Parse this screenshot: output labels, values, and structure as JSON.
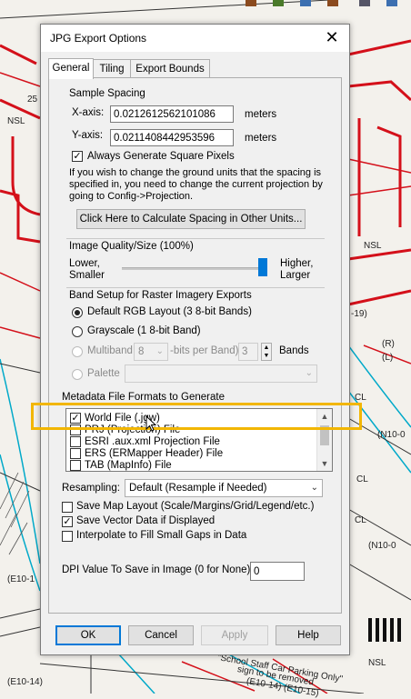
{
  "dialog": {
    "title": "JPG Export Options",
    "close_glyph": "✕",
    "tabs": [
      {
        "label": "General",
        "active": true
      },
      {
        "label": "Tiling",
        "active": false
      },
      {
        "label": "Export Bounds",
        "active": false
      }
    ]
  },
  "sample_spacing": {
    "heading": "Sample Spacing",
    "x_label": "X-axis:",
    "x_value": "0.0212612562101086",
    "x_unit": "meters",
    "y_label": "Y-axis:",
    "y_value": "0.0211408442953596",
    "y_unit": "meters",
    "square_pixels_label": "Always Generate Square Pixels",
    "square_pixels_checked": true,
    "info_text_1": "If you wish to change the ground units that the spacing is",
    "info_text_2": "specified in, you need to change the current projection by",
    "info_text_3": "going to Config->Projection.",
    "calc_button": "Click Here to Calculate Spacing in Other Units..."
  },
  "quality": {
    "heading": "Image Quality/Size (100%)",
    "lower_1": "Lower,",
    "lower_2": "Smaller",
    "higher_1": "Higher,",
    "higher_2": "Larger",
    "level": 1.0
  },
  "band_setup": {
    "heading": "Band Setup for Raster Imagery Exports",
    "rgb_label": "Default RGB Layout (3 8-bit Bands)",
    "gray_label": "Grayscale (1 8-bit Band)",
    "multiband_label": "Multiband (",
    "multiband_bits": "8",
    "multiband_mid": "-bits per Band)",
    "band_count": "3",
    "bands_label": "Bands",
    "palette_label": "Palette",
    "selected": "rgb"
  },
  "metadata": {
    "heading": "Metadata File Formats to Generate",
    "items": [
      {
        "label": "World File (.jgw)",
        "checked": true
      },
      {
        "label": "PRJ (Projection) File",
        "checked": false
      },
      {
        "label": "ESRI .aux.xml Projection File",
        "checked": false
      },
      {
        "label": "ERS (ERMapper Header) File",
        "checked": false
      },
      {
        "label": "TAB (MapInfo) File",
        "checked": false
      }
    ]
  },
  "resampling": {
    "label": "Resampling:",
    "value": "Default (Resample if Needed)"
  },
  "options": [
    {
      "label": "Save Map Layout (Scale/Margins/Grid/Legend/etc.)",
      "checked": false
    },
    {
      "label": "Save Vector Data if Displayed",
      "checked": true
    },
    {
      "label": "Interpolate to Fill Small Gaps in Data",
      "checked": false
    }
  ],
  "dpi": {
    "label": "DPI Value To Save in Image (0 for None)",
    "value": "0"
  },
  "buttons": {
    "ok": "OK",
    "cancel": "Cancel",
    "apply": "Apply",
    "help": "Help"
  },
  "map_labels": {
    "nsl_1": "NSL",
    "num_25": "25",
    "nsl_2": "NSL",
    "code_19": "-19)",
    "ri": "(R)",
    "li": "(L)",
    "cl_1": "CL",
    "n10_1": "(N10-0",
    "cl_2": "CL",
    "n10_2": "(N10-0",
    "cl_3": "CL",
    "e10_1": "(E10-1",
    "e10_2": "(E10-14)",
    "nsl_3": "NSL",
    "school_1": "\"School Staff Car Parking Only\"",
    "school_2": "sign to be removed",
    "school_3": "(E10-14)  (E10-15)"
  },
  "colors": {
    "accent": "#0078d7",
    "highlight": "#f2b600",
    "map_red": "#d4101a",
    "map_cyan": "#00a9c9"
  }
}
